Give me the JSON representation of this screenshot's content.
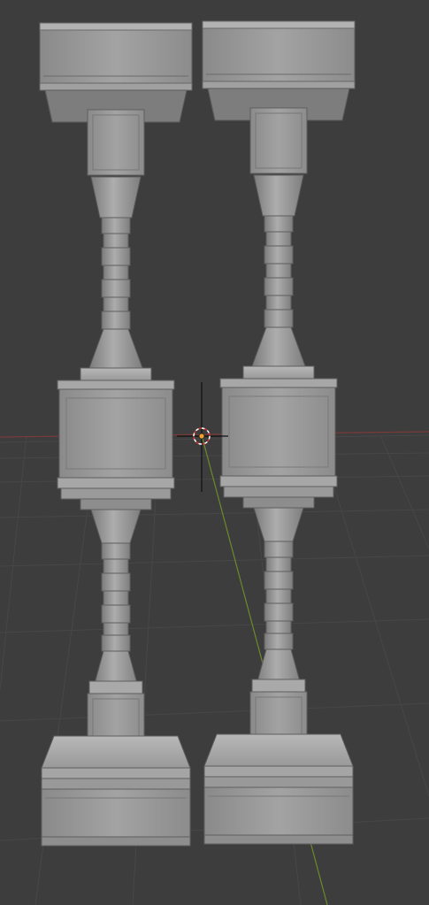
{
  "viewport": {
    "background": "#3d3d3d",
    "grid_color": "#454545",
    "x_axis_color": "#8a3d3d",
    "y_axis_color": "#6b8a2a",
    "model_color": "#9b9b9b",
    "model_shadow": "#6f6f6f",
    "model_highlight": "#b4b4b4"
  },
  "scene_objects": [
    {
      "name": "pillar-left",
      "parts": [
        "top-cap",
        "upper-shaft",
        "center-block",
        "lower-shaft",
        "base"
      ]
    },
    {
      "name": "pillar-right",
      "parts": [
        "top-cap",
        "upper-shaft",
        "center-block",
        "lower-shaft",
        "base"
      ]
    }
  ],
  "origin_marker": {
    "icon": "object-origin-icon",
    "color": "#f0a030"
  },
  "cursor": {
    "icon": "3d-cursor-icon",
    "ring_colors": [
      "#ffffff",
      "#d03030"
    ]
  }
}
